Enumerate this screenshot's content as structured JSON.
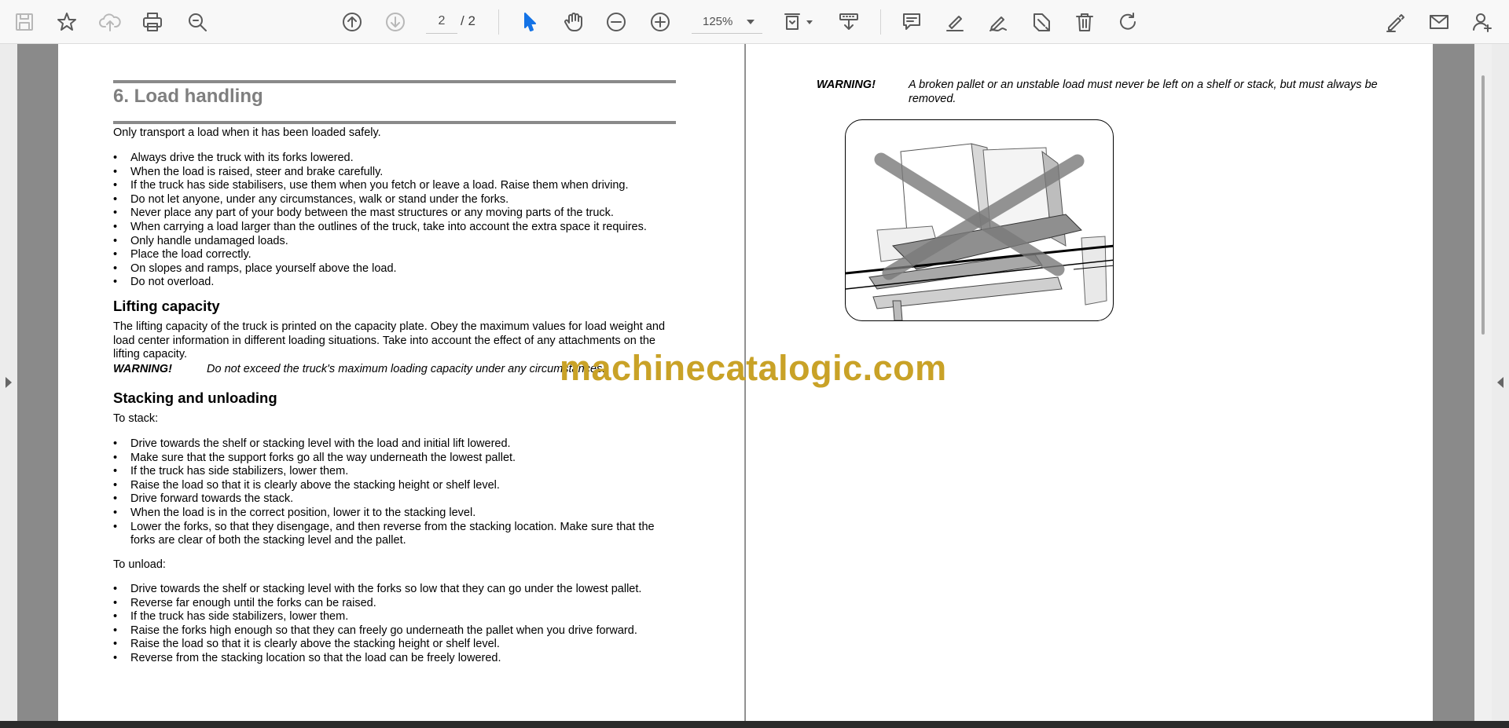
{
  "toolbar": {
    "icons": {
      "save": "save-icon",
      "bookmark": "star-icon",
      "upload": "cloud-upload-icon",
      "print": "printer-icon",
      "find": "search-icon",
      "prev_page": "arrow-up-circle-icon",
      "next_page": "arrow-down-circle-icon",
      "select": "pointer-icon",
      "pan": "hand-icon",
      "zoom_out": "minus-circle-icon",
      "zoom_in": "plus-circle-icon",
      "fit": "fit-page-icon",
      "scroll_mode": "scroll-mode-icon",
      "comment": "comment-icon",
      "highlight": "highlighter-icon",
      "draw": "pen-icon",
      "stamp": "stamp-icon",
      "delete": "trash-icon",
      "rotate": "rotate-icon",
      "fill_sign": "sign-icon",
      "email": "envelope-icon",
      "share": "add-user-icon"
    },
    "page_current": "2",
    "page_total": "/ 2",
    "zoom_level": "125%",
    "accent_color": "#1473e6"
  },
  "doc": {
    "section_title": "6. Load handling",
    "intro": "Only transport a load when it has been loaded safely.",
    "rules": [
      "Always drive the truck with its forks lowered.",
      "When the load is raised, steer and brake carefully.",
      "If the truck has side stabilisers, use them when you fetch or leave a load. Raise them when driving.",
      "Do not let anyone, under any circumstances, walk or stand under the forks.",
      "Never place any part of your body between the mast structures or any moving parts of the truck.",
      "When carrying a load larger than the outlines of the truck, take into account the extra space it requires.",
      "Only handle undamaged loads.",
      "Place the load correctly.",
      "On slopes and ramps, place yourself above the load.",
      "Do not overload."
    ],
    "lifting": {
      "heading": "Lifting capacity",
      "text": "The lifting capacity of the truck is printed on the capacity plate. Obey the maximum values for load weight and load center information in different loading situations. Take into account the effect of any attachments on the lifting capacity.",
      "warning_label": "WARNING!",
      "warning_text": "Do not exceed the truck's maximum loading capacity under any circumstances."
    },
    "stacking": {
      "heading": "Stacking and unloading",
      "stack_intro": "To stack:",
      "stack_steps": [
        "Drive towards the shelf or stacking level with the load and initial lift lowered.",
        "Make sure that the support forks go all the way underneath the lowest pallet.",
        "If the truck has side stabilizers, lower them.",
        "Raise the load so that it is clearly above the stacking height or shelf level.",
        "Drive forward towards the stack.",
        "When the load is in the correct position, lower it to the stacking level.",
        "Lower the forks, so that they disengage, and then reverse from the stacking location. Make sure that the forks are clear of both the stacking level and the pallet."
      ],
      "unload_intro": "To unload:",
      "unload_steps": [
        "Drive towards the shelf or stacking level with the forks so low that they can go under the lowest pallet.",
        "Reverse far enough until the forks can be raised.",
        "If the truck has side stabilizers, lower them.",
        "Raise the forks high enough so that they can freely go underneath the pallet when you drive forward.",
        "Raise the load so that it is clearly above the stacking height or shelf level.",
        "Reverse from the stacking location so that the load can be freely lowered."
      ]
    },
    "right_warning": {
      "label": "WARNING!",
      "text": "A broken pallet or an unstable load must never be left on a shelf or stack, but must always be removed."
    }
  },
  "watermark": "machinecatalogic.com",
  "watermark_color": "#c9a227"
}
